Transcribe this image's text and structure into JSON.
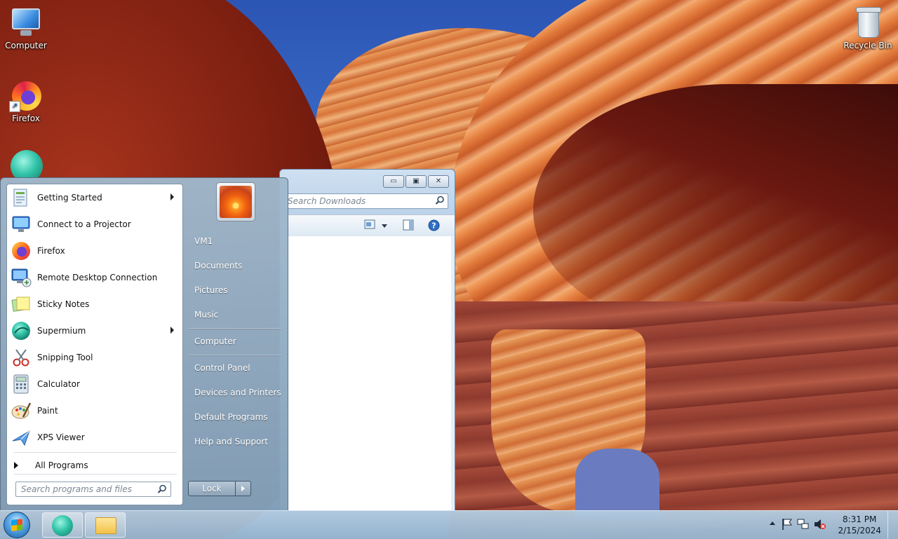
{
  "desktop": {
    "icons": {
      "computer": "Computer",
      "firefox": "Firefox",
      "recycle_bin": "Recycle Bin"
    }
  },
  "explorer": {
    "search_placeholder": "Search Downloads",
    "buttons": {
      "minimize": "▭",
      "maximize": "▣",
      "close": "✕"
    }
  },
  "start_menu": {
    "programs": [
      {
        "label": "Getting Started",
        "icon": "getting-started-icon",
        "submenu": true
      },
      {
        "label": "Connect to a Projector",
        "icon": "projector-icon",
        "submenu": false
      },
      {
        "label": "Firefox",
        "icon": "firefox-icon",
        "submenu": false
      },
      {
        "label": "Remote Desktop Connection",
        "icon": "remote-desktop-icon",
        "submenu": false
      },
      {
        "label": "Sticky Notes",
        "icon": "sticky-notes-icon",
        "submenu": false
      },
      {
        "label": "Supermium",
        "icon": "supermium-icon",
        "submenu": true
      },
      {
        "label": "Snipping Tool",
        "icon": "snipping-tool-icon",
        "submenu": false
      },
      {
        "label": "Calculator",
        "icon": "calculator-icon",
        "submenu": false
      },
      {
        "label": "Paint",
        "icon": "paint-icon",
        "submenu": false
      },
      {
        "label": "XPS Viewer",
        "icon": "xps-viewer-icon",
        "submenu": false
      }
    ],
    "all_programs": "All Programs",
    "search_placeholder": "Search programs and files",
    "places": {
      "user": "VM1",
      "documents": "Documents",
      "pictures": "Pictures",
      "music": "Music",
      "computer": "Computer",
      "control_panel": "Control Panel",
      "devices_printers": "Devices and Printers",
      "default_programs": "Default Programs",
      "help_support": "Help and Support"
    },
    "lock_label": "Lock"
  },
  "taskbar": {
    "time": "8:31 PM",
    "date": "2/15/2024"
  }
}
